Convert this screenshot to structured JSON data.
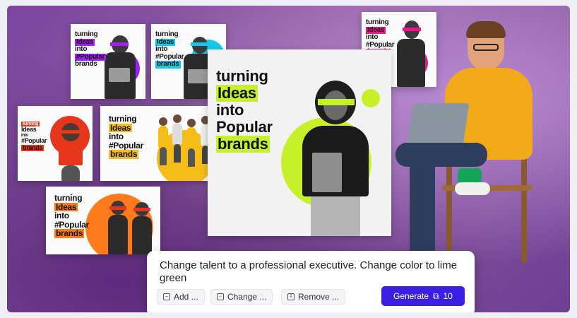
{
  "prompt": {
    "text": "Change talent to a professional executive. Change color to lime green",
    "chips": [
      "Add ...",
      "Change ...",
      "Remove ..."
    ],
    "generate_label": "Generate",
    "credits_icon": "copy-stack-icon",
    "credits": "10"
  },
  "cards": {
    "a": [
      "turning",
      "Ideas",
      "into",
      "#Popular",
      "brands"
    ],
    "b": [
      "turning",
      "Ideas",
      "into",
      "#Popular",
      "brands"
    ],
    "c": [
      "turning",
      "Ideas",
      "into",
      "#Popular",
      "brands"
    ],
    "main": [
      "turning",
      "Ideas",
      "into",
      "Popular",
      "brands"
    ],
    "d": [
      "turning",
      "Ideas",
      "into",
      "#Popular",
      "brands"
    ],
    "e": [
      "turning",
      "Ideas",
      "into",
      "#Popular",
      "brands"
    ],
    "f": [
      "turning",
      "Ideas",
      "into",
      "#Popular",
      "brands"
    ]
  },
  "colors": {
    "purple": "#a020f0",
    "cyan": "#18c7e8",
    "magenta": "#e8188c",
    "lime": "#c6f12a",
    "red": "#e6361c",
    "yellow": "#f6bd1a",
    "orange": "#ff7a1a",
    "generate": "#3b1fe0"
  }
}
